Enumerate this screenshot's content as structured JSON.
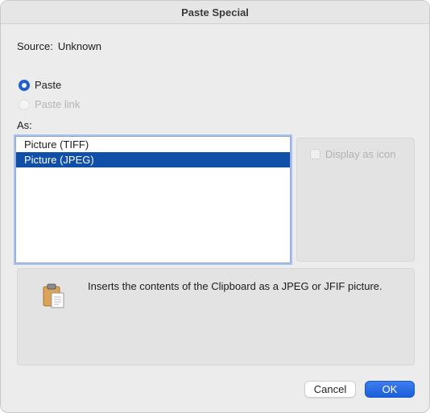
{
  "window": {
    "title": "Paste Special"
  },
  "source": {
    "label": "Source:",
    "value": "Unknown"
  },
  "options": {
    "paste_label": "Paste",
    "paste_link_label": "Paste link",
    "selected": "paste"
  },
  "as": {
    "label": "As:",
    "items": [
      "Picture (TIFF)",
      "Picture (JPEG)"
    ],
    "selected_index": 1
  },
  "display_as_icon": {
    "label": "Display as icon",
    "checked": false,
    "enabled": false
  },
  "result": {
    "icon": "clipboard-picture-icon",
    "text": "Inserts the contents of the Clipboard as a JPEG or JFIF picture."
  },
  "buttons": {
    "cancel": "Cancel",
    "ok": "OK"
  },
  "colors": {
    "accent": "#1f5fd1",
    "selection": "#0f4fa8"
  }
}
